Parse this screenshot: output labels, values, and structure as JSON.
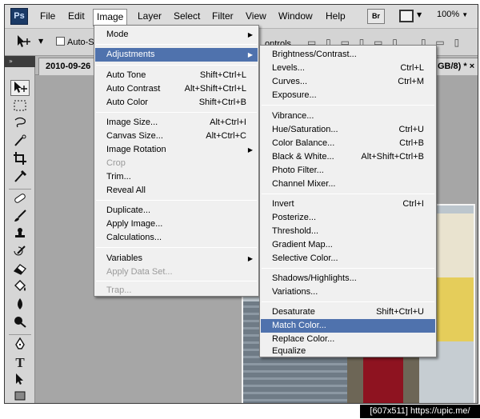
{
  "app": {
    "logo": "Ps",
    "menus": [
      "File",
      "Edit",
      "Image",
      "Layer",
      "Select",
      "Filter",
      "View",
      "Window",
      "Help"
    ],
    "bridge_button": "Br",
    "zoom": "100%",
    "zoom_arrow": "▼",
    "screen_mode_arrow": "▼"
  },
  "options_bar": {
    "auto_select_label": "Auto-S",
    "controls_label": "ontrols",
    "align_icons": "▭ ▯ ▭ ▯ ▭ ▯",
    "distribute_icons": "▯ ▭ ▯",
    "tool_arrow": "▼"
  },
  "document": {
    "tab_title": "2010-09-26",
    "tab_suffix": "GB/8) *",
    "close_glyph": "×"
  },
  "toolbox": {
    "header": "»",
    "tools": [
      "move-tool",
      "marquee-tool",
      "lasso-tool",
      "quick-select-tool",
      "crop-tool",
      "eyedropper-tool",
      "healing-tool",
      "brush-tool",
      "clone-stamp-tool",
      "history-brush-tool",
      "eraser-tool",
      "paint-bucket-tool",
      "blur-tool",
      "dodge-tool",
      "pen-tool",
      "type-tool",
      "path-select-tool",
      "shape-tool"
    ]
  },
  "image_menu": {
    "items": [
      {
        "label": "Mode",
        "shortcut": "",
        "submenu": true,
        "disabled": false
      },
      {
        "label": "Adjustments",
        "shortcut": "",
        "submenu": true,
        "disabled": false,
        "highlighted": true
      },
      {
        "label": "Auto Tone",
        "shortcut": "Shift+Ctrl+L",
        "disabled": false
      },
      {
        "label": "Auto Contrast",
        "shortcut": "Alt+Shift+Ctrl+L",
        "disabled": false
      },
      {
        "label": "Auto Color",
        "shortcut": "Shift+Ctrl+B",
        "disabled": false
      },
      {
        "label": "Image Size...",
        "shortcut": "Alt+Ctrl+I",
        "disabled": false
      },
      {
        "label": "Canvas Size...",
        "shortcut": "Alt+Ctrl+C",
        "disabled": false
      },
      {
        "label": "Image Rotation",
        "shortcut": "",
        "submenu": true,
        "disabled": false
      },
      {
        "label": "Crop",
        "shortcut": "",
        "disabled": true
      },
      {
        "label": "Trim...",
        "shortcut": "",
        "disabled": false
      },
      {
        "label": "Reveal All",
        "shortcut": "",
        "disabled": false
      },
      {
        "label": "Duplicate...",
        "shortcut": "",
        "disabled": false
      },
      {
        "label": "Apply Image...",
        "shortcut": "",
        "disabled": false
      },
      {
        "label": "Calculations...",
        "shortcut": "",
        "disabled": false
      },
      {
        "label": "Variables",
        "shortcut": "",
        "submenu": true,
        "disabled": false
      },
      {
        "label": "Apply Data Set...",
        "shortcut": "",
        "disabled": true
      },
      {
        "label": "Trap...",
        "shortcut": "",
        "disabled": true
      }
    ]
  },
  "adjustments_menu": {
    "items": [
      {
        "label": "Brightness/Contrast...",
        "shortcut": ""
      },
      {
        "label": "Levels...",
        "shortcut": "Ctrl+L"
      },
      {
        "label": "Curves...",
        "shortcut": "Ctrl+M"
      },
      {
        "label": "Exposure...",
        "shortcut": ""
      },
      {
        "label": "Vibrance...",
        "shortcut": ""
      },
      {
        "label": "Hue/Saturation...",
        "shortcut": "Ctrl+U"
      },
      {
        "label": "Color Balance...",
        "shortcut": "Ctrl+B"
      },
      {
        "label": "Black & White...",
        "shortcut": "Alt+Shift+Ctrl+B"
      },
      {
        "label": "Photo Filter...",
        "shortcut": ""
      },
      {
        "label": "Channel Mixer...",
        "shortcut": ""
      },
      {
        "label": "Invert",
        "shortcut": "Ctrl+I"
      },
      {
        "label": "Posterize...",
        "shortcut": ""
      },
      {
        "label": "Threshold...",
        "shortcut": ""
      },
      {
        "label": "Gradient Map...",
        "shortcut": ""
      },
      {
        "label": "Selective Color...",
        "shortcut": ""
      },
      {
        "label": "Shadows/Highlights...",
        "shortcut": ""
      },
      {
        "label": "Variations...",
        "shortcut": ""
      },
      {
        "label": "Desaturate",
        "shortcut": "Shift+Ctrl+U"
      },
      {
        "label": "Match Color...",
        "shortcut": "",
        "highlighted": true
      },
      {
        "label": "Replace Color...",
        "shortcut": ""
      },
      {
        "label": "Equalize",
        "shortcut": ""
      }
    ]
  },
  "colors": {
    "highlight": "#4f72ad",
    "menu_bg": "#f0f0f0",
    "workspace": "#a9a9a9"
  },
  "watermark": "[607x511] https://upic.me/"
}
